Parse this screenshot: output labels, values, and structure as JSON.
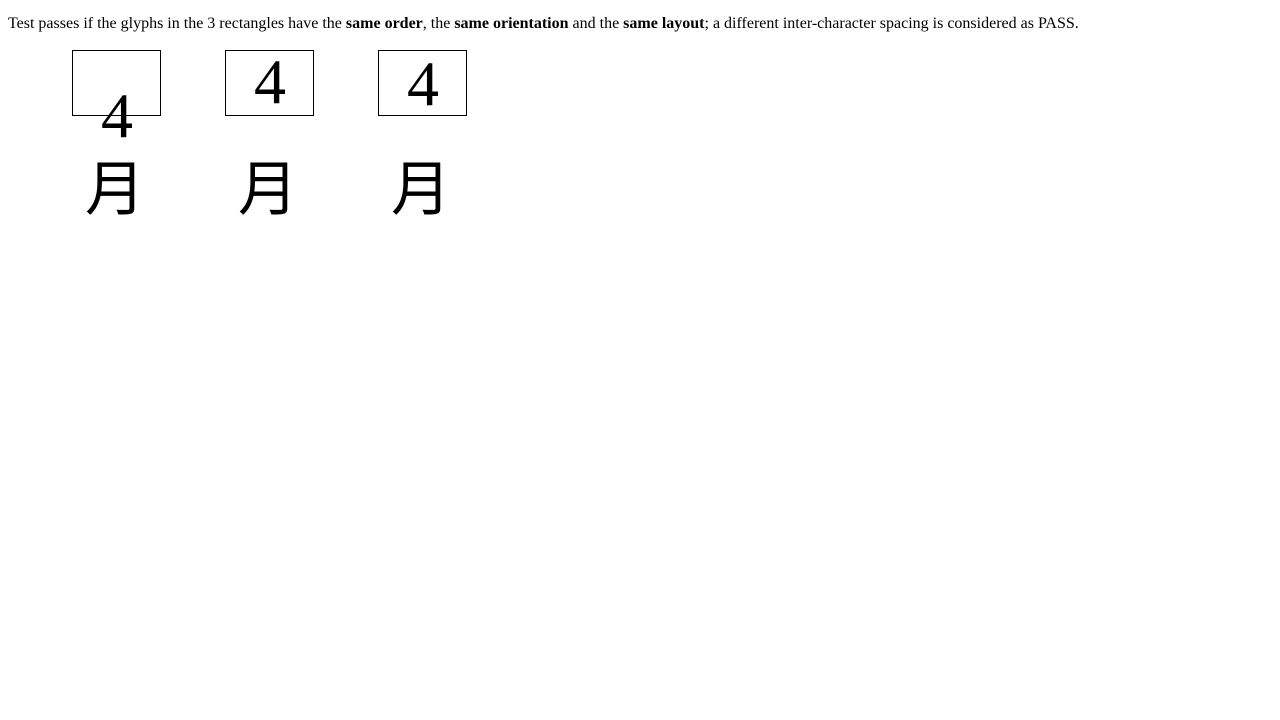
{
  "instructions": {
    "part1": "Test passes if the glyphs in the 3 rectangles have the ",
    "bold1": "same order",
    "part2": ", the ",
    "bold2": "same orientation",
    "part3": " and the ",
    "bold3": "same layout",
    "part4": "; a different inter-character spacing is considered as PASS."
  },
  "samples": [
    {
      "digit": "4",
      "cjk": "月"
    },
    {
      "digit": "4",
      "cjk": "月"
    },
    {
      "digit": "4",
      "cjk": "月"
    }
  ]
}
